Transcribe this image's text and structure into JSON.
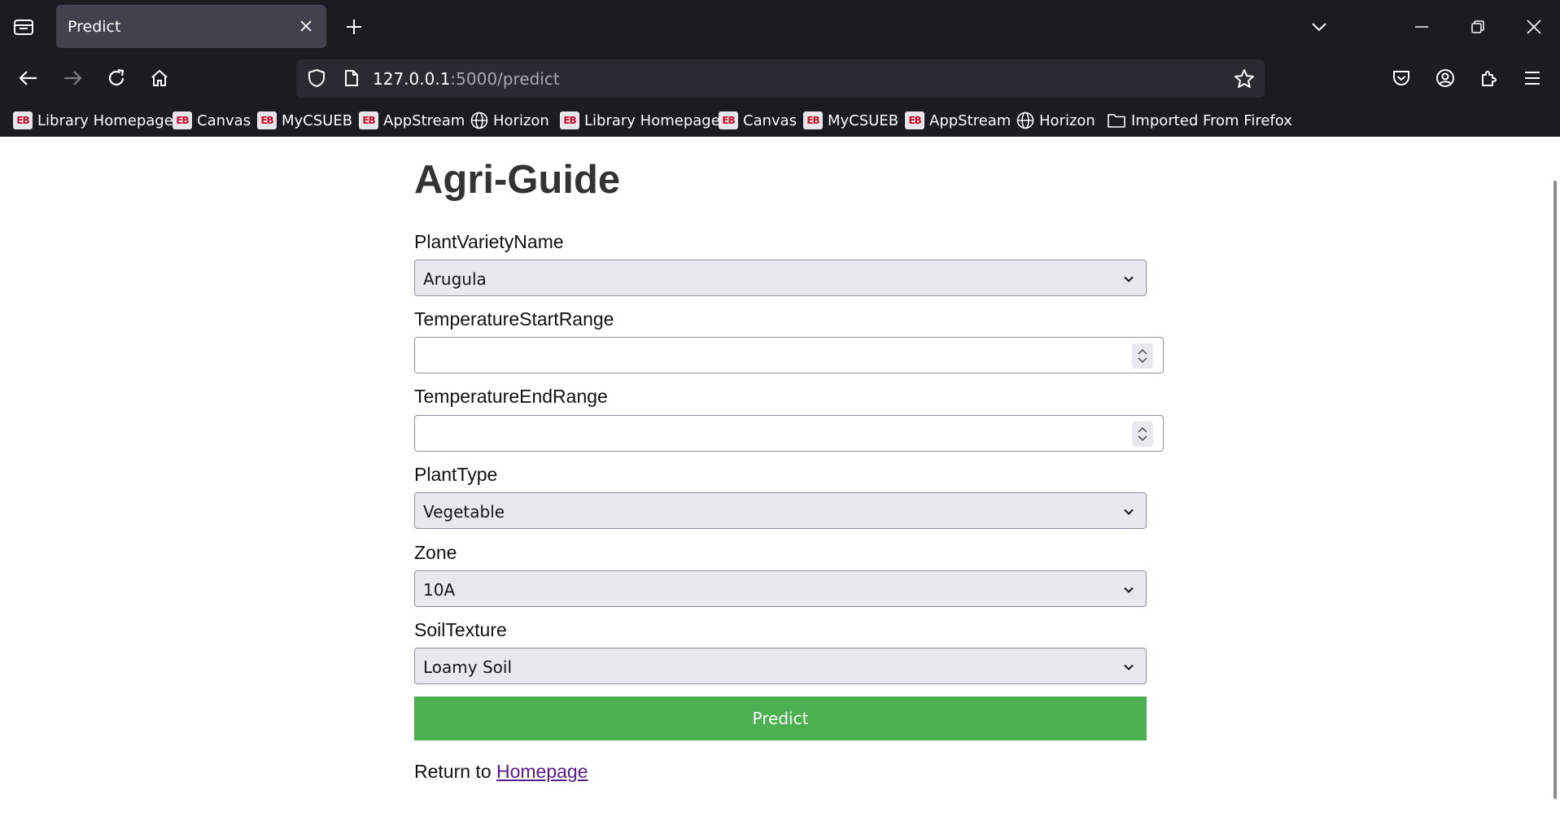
{
  "browser": {
    "tab_title": "Predict",
    "url_host": "127.0.0.1",
    "url_path": ":5000/predict",
    "bookmarks": [
      {
        "label": "Library Homepage",
        "icon": "eb-icon"
      },
      {
        "label": "Canvas",
        "icon": "eb-icon"
      },
      {
        "label": "MyCSUEB",
        "icon": "eb-icon"
      },
      {
        "label": "AppStream",
        "icon": "eb-icon"
      },
      {
        "label": "Horizon",
        "icon": "globe-icon"
      },
      {
        "label": "Library Homepage",
        "icon": "eb-icon"
      },
      {
        "label": "Canvas",
        "icon": "eb-icon"
      },
      {
        "label": "MyCSUEB",
        "icon": "eb-icon"
      },
      {
        "label": "AppStream",
        "icon": "eb-icon"
      },
      {
        "label": "Horizon",
        "icon": "globe-icon"
      },
      {
        "label": "Imported From Firefox",
        "icon": "folder-icon"
      }
    ]
  },
  "form": {
    "title": "Agri-Guide",
    "plant_variety": {
      "label": "PlantVarietyName",
      "value": "Arugula"
    },
    "temp_start": {
      "label": "TemperatureStartRange",
      "value": ""
    },
    "temp_end": {
      "label": "TemperatureEndRange",
      "value": ""
    },
    "plant_type": {
      "label": "PlantType",
      "value": "Vegetable"
    },
    "zone": {
      "label": "Zone",
      "value": "10A"
    },
    "soil_texture": {
      "label": "SoilTexture",
      "value": "Loamy Soil"
    },
    "submit_label": "Predict",
    "return_text": "Return to ",
    "return_link": "Homepage"
  },
  "colors": {
    "chrome_bg": "#1c1b22",
    "active_tab": "#42414d",
    "urlbar_bg": "#2b2a33",
    "predict_button": "#4caf50",
    "link_visited": "#551a8b"
  }
}
